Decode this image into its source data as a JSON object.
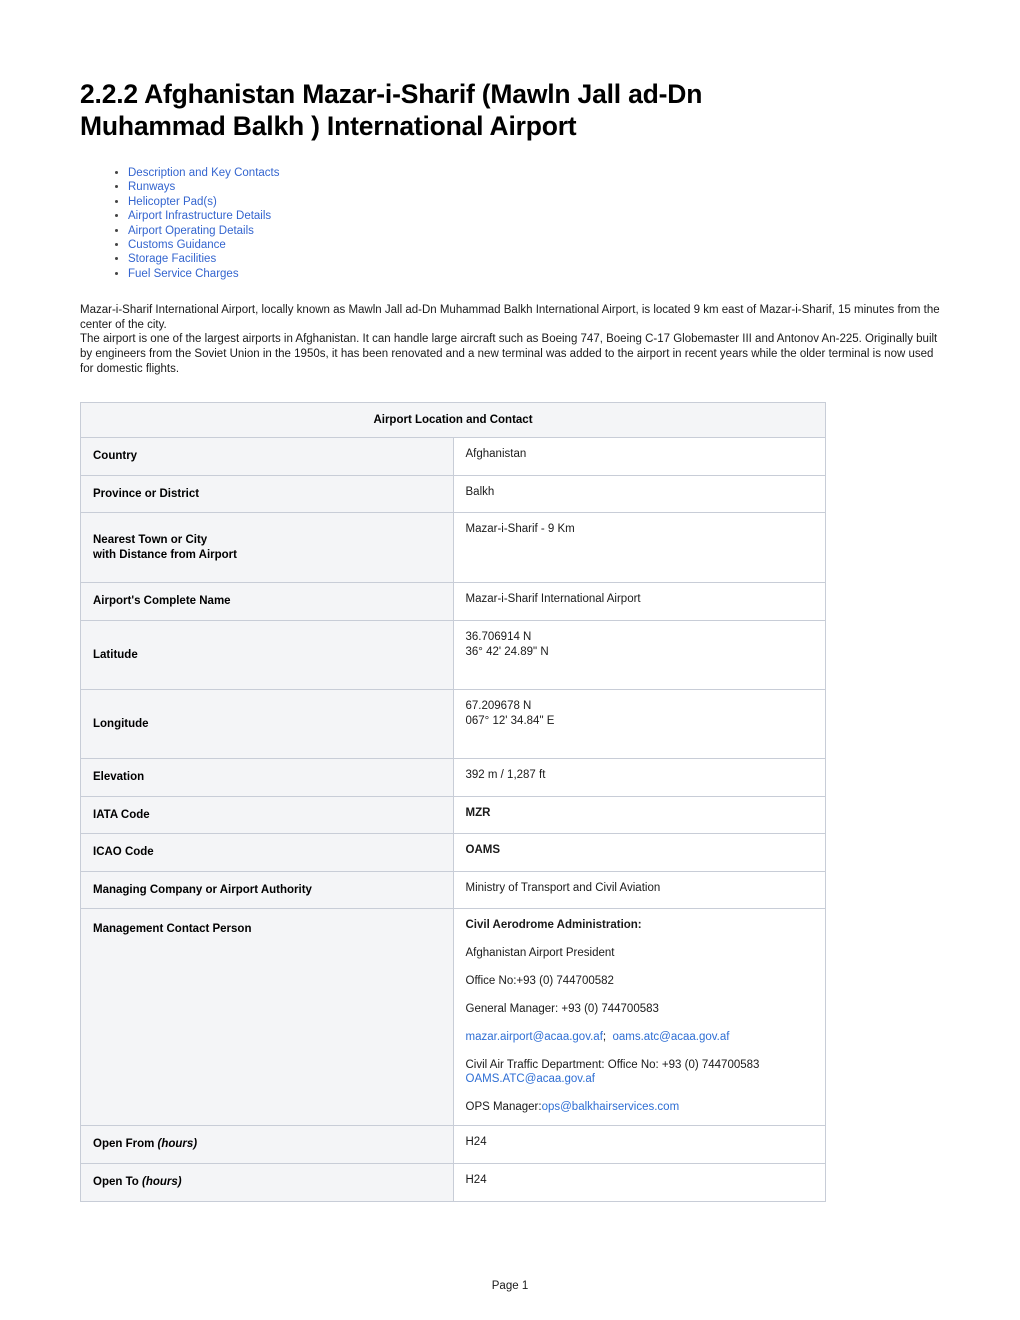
{
  "document": {
    "title": "2.2.2 Afghanistan Mazar-i-Sharif (Mawln Jall ad-Dn Muhammad Balkh ) International Airport",
    "footer": "Page 1"
  },
  "toc": {
    "items": [
      {
        "label": "Description and Key Contacts"
      },
      {
        "label": "Runways"
      },
      {
        "label": "Helicopter Pad(s)"
      },
      {
        "label": "Airport Infrastructure Details"
      },
      {
        "label": "Airport Operating Details"
      },
      {
        "label": "Customs Guidance"
      },
      {
        "label": "Storage Facilities"
      },
      {
        "label": "Fuel Service Charges"
      }
    ]
  },
  "intro": {
    "paragraph1": "Mazar-i-Sharif International Airport, locally known as Mawln Jall ad-Dn Muhammad Balkh International Airport, is located 9 km east of Mazar-i-Sharif, 15 minutes from the center of the city.",
    "paragraph2": "The airport is one of the largest airports in Afghanistan. It can handle large aircraft such as Boeing 747, Boeing C-17 Globemaster III and Antonov An-225. Originally built by engineers from the Soviet Union in the 1950s, it has been renovated and a new terminal was added to the airport in recent years while the older terminal is now used for domestic flights."
  },
  "table": {
    "section_header": "Airport Location and Contact",
    "rows": {
      "country": {
        "label": "Country",
        "value": "Afghanistan"
      },
      "province": {
        "label": "Province or District",
        "value": "Balkh"
      },
      "nearest_town": {
        "label_line1": "Nearest Town or City",
        "label_line2": "with Distance from Airport",
        "value": "Mazar-i-Sharif - 9 Km"
      },
      "complete_name": {
        "label": "Airport's Complete Name",
        "value": "Mazar-i-Sharif International Airport"
      },
      "latitude": {
        "label": "Latitude",
        "value_line1": "36.706914 N",
        "value_line2": "36° 42' 24.89\" N"
      },
      "longitude": {
        "label": "Longitude",
        "value_line1": "67.209678 N",
        "value_line2": "067° 12' 34.84\" E"
      },
      "elevation": {
        "label": "Elevation",
        "value": "392 m / 1,287 ft"
      },
      "iata": {
        "label": "IATA Code",
        "value": "MZR"
      },
      "icao": {
        "label": "ICAO Code",
        "value": "OAMS"
      },
      "managing_company": {
        "label": "Managing Company or Airport Authority",
        "value": "Ministry of Transport and Civil Aviation"
      },
      "management_contact": {
        "label": "Management Contact Person",
        "heading": "Civil Aerodrome Administration:",
        "line_president": "Afghanistan Airport President",
        "line_office": "Office No:+93 (0) 744700582",
        "line_general_manager": "General Manager: +93 (0) 744700583",
        "email_1": "mazar.airport@acaa.gov.af",
        "email_separator": ";",
        "email_2": "oams.atc@acaa.gov.af",
        "atc_prefix": "Civil Air Traffic Department: Office No: +93 (0) 744700583 ",
        "atc_email": "OAMS.ATC@acaa.gov.af",
        "ops_prefix": "OPS Manager:",
        "ops_email": "ops@balkhairservices.com"
      },
      "open_from": {
        "label_main": "Open From ",
        "label_italic": "(hours)",
        "value": "H24"
      },
      "open_to": {
        "label_main": "Open To ",
        "label_italic": "(hours)",
        "value": "H24"
      }
    }
  },
  "colors": {
    "link": "#3465cf",
    "mail_link": "#2e6ed4",
    "table_border": "#c8cdd7",
    "label_bg": "#f4f5f7",
    "text": "#1a1a1a"
  }
}
